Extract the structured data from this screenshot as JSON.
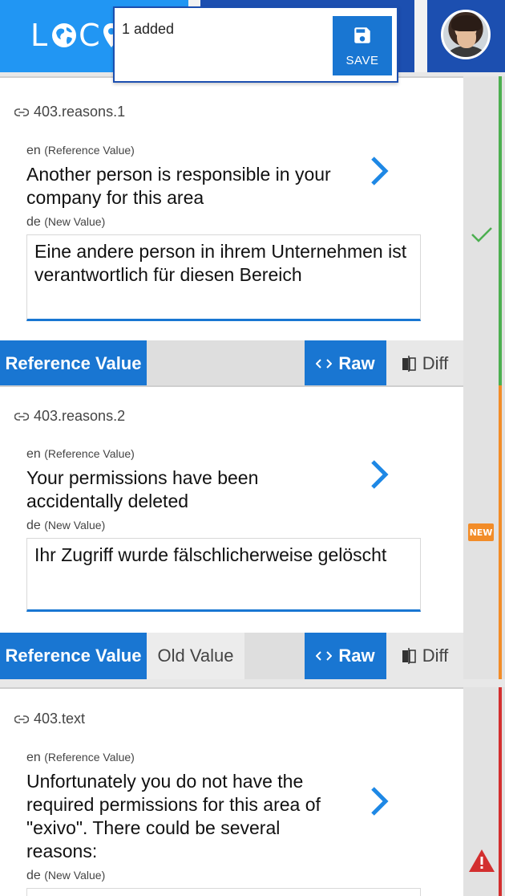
{
  "app": {
    "logo_text": "LOC"
  },
  "header": {
    "avatar_alt": "user avatar"
  },
  "save_popup": {
    "count_label": "1 added",
    "save_label": "SAVE"
  },
  "colors": {
    "primary": "#1976d2",
    "appbar": "#1c4fb0",
    "logo_bg": "#2196f3",
    "ok": "#4caf50",
    "new": "#f28c28",
    "error": "#d32f2f"
  },
  "entries": [
    {
      "key": "403.reasons.1",
      "ref_lang": "en",
      "ref_tag": "(Reference Value)",
      "ref_value": "Another person is responsible in your company for this area",
      "new_lang": "de",
      "new_tag": "(New Value)",
      "new_value": "Eine andere person in ihrem Unternehmen ist verantwortlich für diesen Bereich",
      "status": "ok",
      "tabs": {
        "reference": "Reference Value",
        "raw": "Raw",
        "diff": "Diff"
      }
    },
    {
      "key": "403.reasons.2",
      "ref_lang": "en",
      "ref_tag": "(Reference Value)",
      "ref_value": "Your permissions have been accidentally deleted",
      "new_lang": "de",
      "new_tag": "(New Value)",
      "new_value": "Ihr Zugriff wurde fälschlicherweise gelöscht",
      "status": "new",
      "status_label": "NEW",
      "tabs": {
        "reference": "Reference Value",
        "old": "Old Value",
        "raw": "Raw",
        "diff": "Diff"
      }
    },
    {
      "key": "403.text",
      "ref_lang": "en",
      "ref_tag": "(Reference Value)",
      "ref_value": "Unfortunately you do not have the required permissions for this area of \"exivo\". There could be several reasons:",
      "new_lang": "de",
      "new_tag": "(New Value)",
      "status": "error"
    }
  ]
}
